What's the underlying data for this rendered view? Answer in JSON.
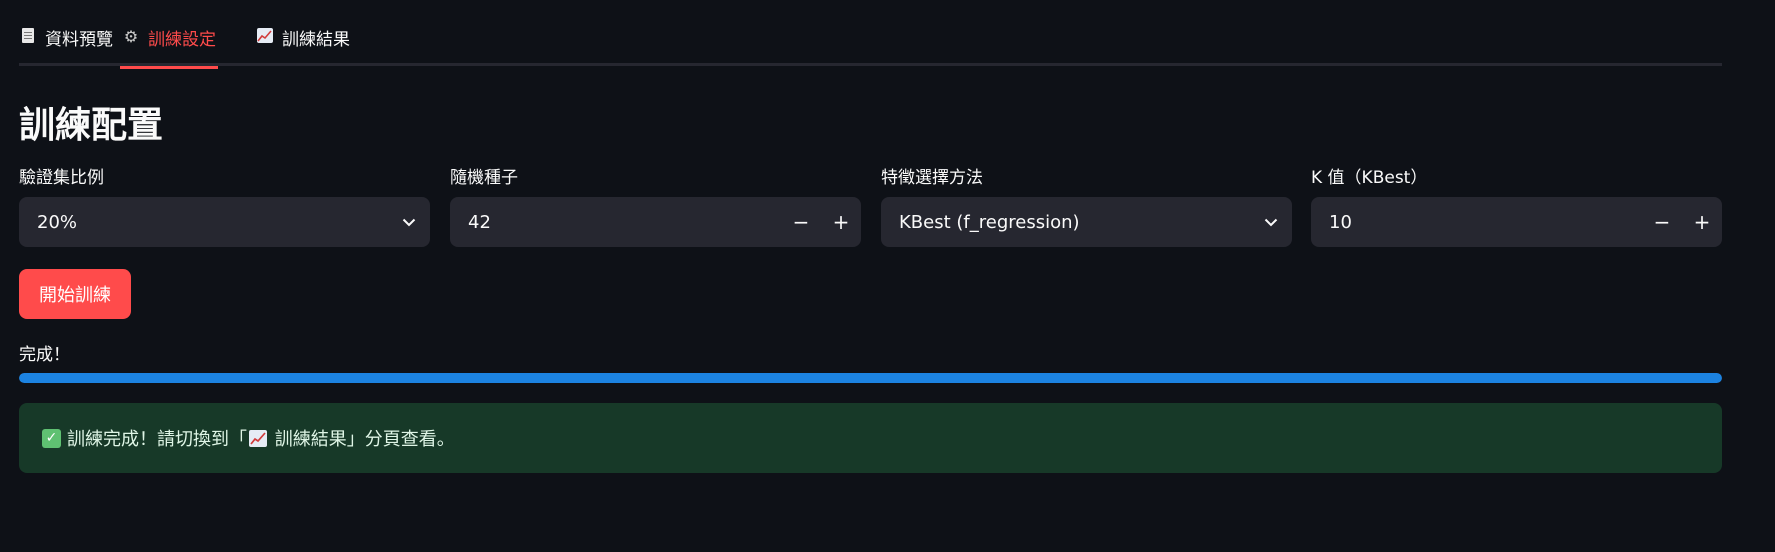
{
  "tabs": [
    {
      "label": "資料預覽",
      "icon": "document-icon",
      "active": false
    },
    {
      "label": "訓練設定",
      "icon": "gear-icon",
      "active": true
    },
    {
      "label": "訓練結果",
      "icon": "chart-icon",
      "active": false
    }
  ],
  "title": "訓練配置",
  "fields": {
    "validation_ratio": {
      "label": "驗證集比例",
      "value": "20%"
    },
    "random_seed": {
      "label": "隨機種子",
      "value": "42"
    },
    "feature_method": {
      "label": "特徵選擇方法",
      "value": "KBest (f_regression)"
    },
    "k_value": {
      "label": "K 值（KBest）",
      "value": "10"
    }
  },
  "stepper": {
    "minus": "−",
    "plus": "+"
  },
  "train_button": "開始訓練",
  "progress": {
    "label": "完成！",
    "value_percent": 100
  },
  "alert": {
    "text_before": "訓練完成！請切換到「",
    "text_tab": "訓練結果",
    "text_after": "」分頁查看。"
  },
  "colors": {
    "background": "#0e1117",
    "accent": "#ff4b4b",
    "progress": "#1c83e1",
    "success_bg": "#173928"
  }
}
